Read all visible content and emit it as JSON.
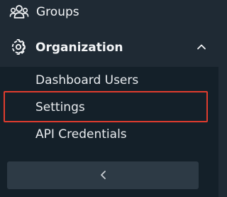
{
  "sidebar": {
    "items": [
      {
        "label": "Groups",
        "icon": "people-group-icon"
      },
      {
        "label": "Organization",
        "icon": "gear-icon",
        "expanded": true
      }
    ],
    "organization_submenu": [
      {
        "label": "Dashboard Users"
      },
      {
        "label": "Settings",
        "highlighted": true
      },
      {
        "label": "API Credentials"
      }
    ],
    "collapse_button": {
      "icon": "chevron-left-icon"
    }
  },
  "colors": {
    "background": "#1f2a34",
    "submenu_background": "#142029",
    "text": "#f2f4f6",
    "highlight_border": "#e03c2e",
    "collapse_button_bg": "#2d3a45"
  }
}
